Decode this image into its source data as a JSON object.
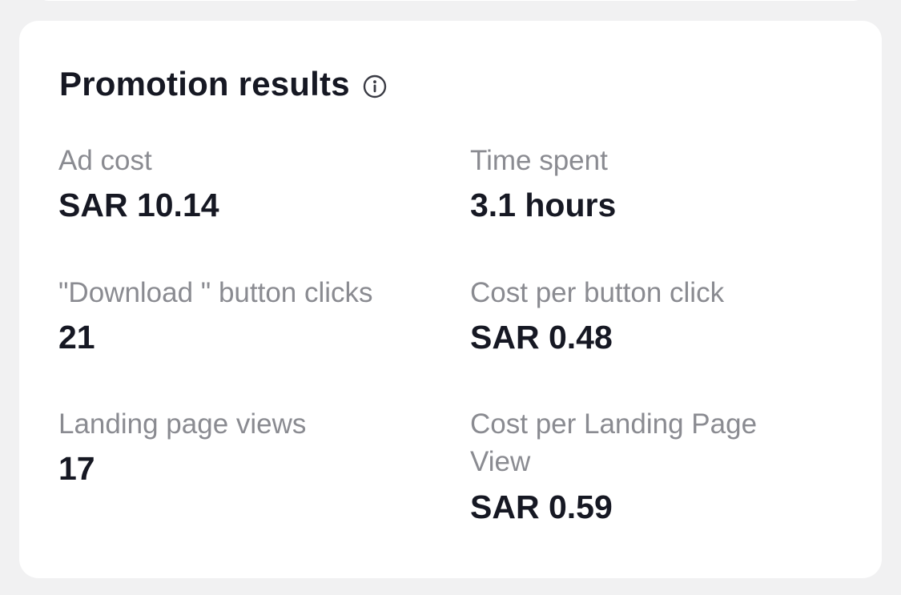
{
  "panel": {
    "title": "Promotion results",
    "info_icon": "info-circle-icon"
  },
  "metrics": [
    {
      "label": "Ad cost",
      "value": "SAR 10.14"
    },
    {
      "label": "Time spent",
      "value": "3.1 hours"
    },
    {
      "label": "\"Download \" button clicks",
      "value": "21"
    },
    {
      "label": "Cost per button click",
      "value": "SAR 0.48"
    },
    {
      "label": "Landing page views",
      "value": "17"
    },
    {
      "label": "Cost per Landing Page View",
      "value": "SAR 0.59"
    }
  ],
  "colors": {
    "page_background": "#f1f1f2",
    "card_background": "#ffffff",
    "label_text": "#8a8b91",
    "value_text": "#161823"
  }
}
